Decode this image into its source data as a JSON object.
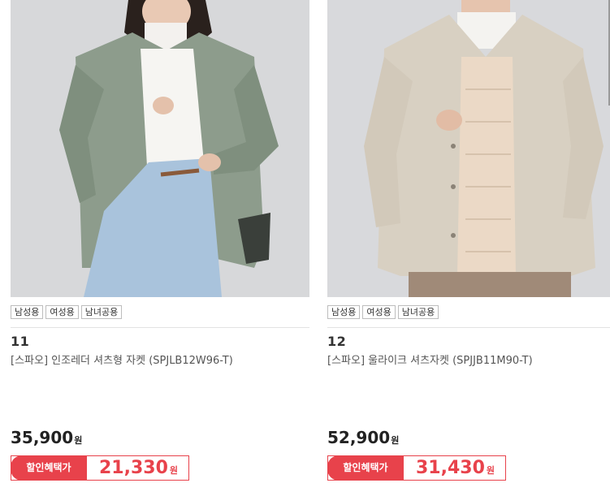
{
  "products": [
    {
      "number": "11",
      "tags": [
        "남성용",
        "여성용",
        "남녀공용"
      ],
      "name": "[스파오] 인조레더 셔츠형 자켓 (SPJLB12W96-T)",
      "price": "35,900",
      "price_unit": "원",
      "sale_label": "할인혜택가",
      "sale_price": "21,330",
      "sale_unit": "원",
      "image": "woman-sage-green-faux-leather-shirt-jacket"
    },
    {
      "number": "12",
      "tags": [
        "남성용",
        "여성용",
        "남녀공용"
      ],
      "name": "[스파오] 울라이크 셔츠자켓 (SPJJB11M90-T)",
      "price": "52,900",
      "price_unit": "원",
      "sale_label": "할인혜택가",
      "sale_price": "31,430",
      "sale_unit": "원",
      "image": "man-oatmeal-wool-shirt-jacket"
    }
  ],
  "colors": {
    "accent": "#e8424b",
    "jacket1": "#8a9a8a",
    "jacket2": "#d9d2c4"
  }
}
